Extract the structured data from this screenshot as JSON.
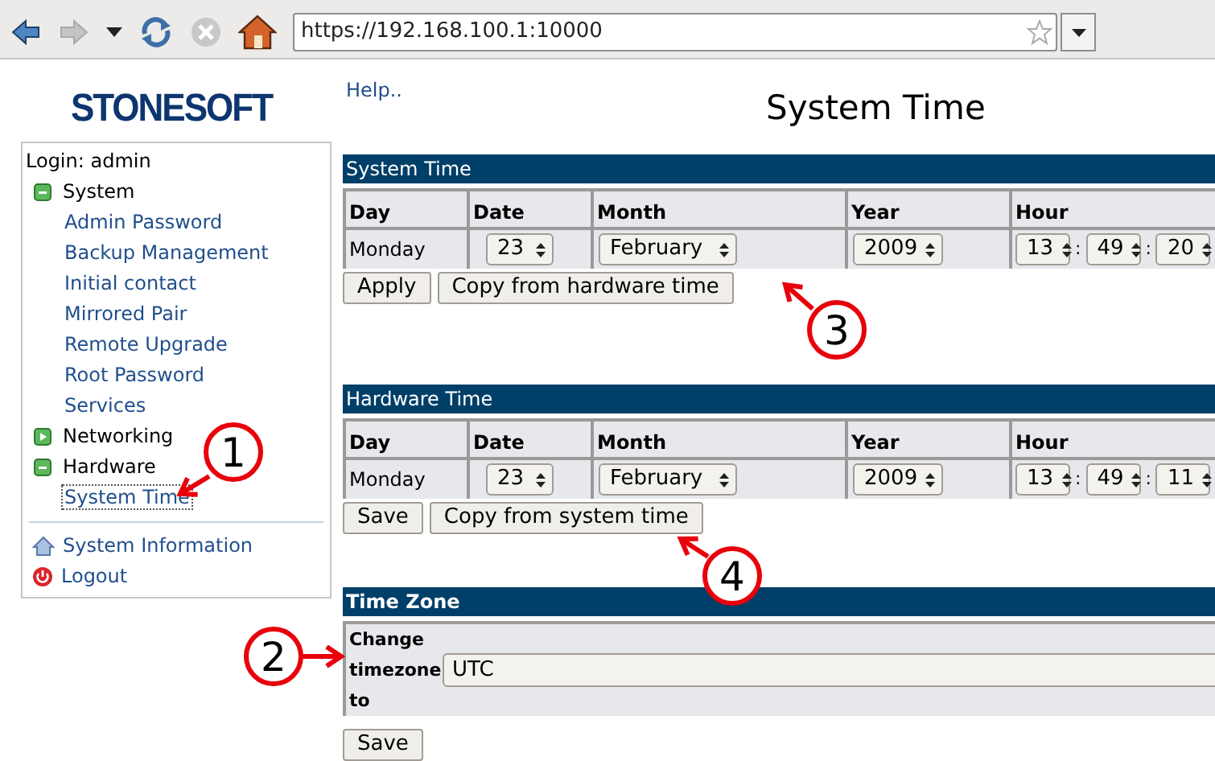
{
  "browser": {
    "url": "https://192.168.100.1:10000",
    "back_disabled": false,
    "forward_disabled": true,
    "stop_disabled": true
  },
  "sidebar": {
    "logo": "STONESOFT",
    "login": "Login: admin",
    "tree": [
      {
        "label": "System",
        "expanded": true,
        "children": [
          {
            "label": "Admin Password",
            "selected": false
          },
          {
            "label": "Backup Management",
            "selected": false
          },
          {
            "label": "Initial contact",
            "selected": false
          },
          {
            "label": "Mirrored Pair",
            "selected": false
          },
          {
            "label": "Remote Upgrade",
            "selected": false
          },
          {
            "label": "Root Password",
            "selected": false
          },
          {
            "label": "Services",
            "selected": false
          }
        ]
      },
      {
        "label": "Networking",
        "expanded": false
      },
      {
        "label": "Hardware",
        "expanded": true,
        "children": [
          {
            "label": "System Time",
            "selected": true
          }
        ]
      }
    ],
    "links": [
      {
        "kind": "info",
        "label": "System Information"
      },
      {
        "kind": "logout",
        "label": "Logout"
      }
    ]
  },
  "help_link": "Help..",
  "page_title": "System Time",
  "time_panels": [
    {
      "title": "System Time",
      "columns": [
        "Day",
        "Date",
        "Month",
        "Year",
        "Hour"
      ],
      "day": "Monday",
      "date": "23",
      "month": "February",
      "year": "2009",
      "time_parts": [
        {
          "kind": "spinner",
          "text": "13"
        },
        {
          "kind": "separator",
          "text": ":"
        },
        {
          "kind": "spinner",
          "text": "49"
        },
        {
          "kind": "separator",
          "text": ":"
        },
        {
          "kind": "spinner",
          "text": "20"
        }
      ],
      "buttons": [
        "Apply",
        "Copy from hardware time"
      ]
    },
    {
      "title": "Hardware Time",
      "columns": [
        "Day",
        "Date",
        "Month",
        "Year",
        "Hour"
      ],
      "day": "Monday",
      "date": "23",
      "month": "February",
      "year": "2009",
      "time_parts": [
        {
          "kind": "spinner",
          "text": "13"
        },
        {
          "kind": "separator",
          "text": ":"
        },
        {
          "kind": "spinner",
          "text": "49"
        },
        {
          "kind": "separator",
          "text": ":"
        },
        {
          "kind": "spinner",
          "text": "11"
        }
      ],
      "buttons": [
        "Save",
        "Copy from system time"
      ]
    }
  ],
  "timezone_panel": {
    "title": "Time Zone",
    "label": "Change timezone to",
    "value": "UTC",
    "button": "Save"
  },
  "annotations": [
    {
      "label": "1"
    },
    {
      "label": "2"
    },
    {
      "label": "3"
    },
    {
      "label": "4"
    }
  ]
}
